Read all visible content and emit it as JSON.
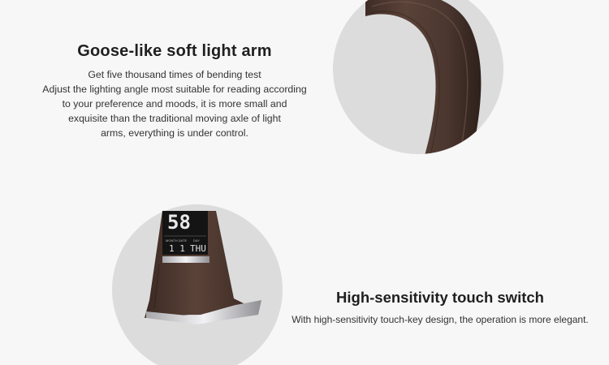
{
  "section_arm": {
    "title": "Goose-like soft light arm",
    "description_lines": [
      "Get five thousand times of bending test",
      "Adjust the lighting angle most suitable for reading according",
      "to your preference and moods, it is more small and",
      "exquisite than the traditional moving axle of light",
      "arms, everything is under control."
    ],
    "image_icon": "lamp-arm-photo"
  },
  "section_touch": {
    "title": "High-sensitivity touch switch",
    "description": "With high-sensitivity touch-key design, the operation is more elegant.",
    "image_icon": "lamp-base-photo",
    "display": {
      "big_digits": "58",
      "left_label": "MONTH DATE",
      "right_label": "DAY",
      "date_value": "1 1",
      "day_value": "THU"
    }
  },
  "colors": {
    "background": "#f7f7f7",
    "circle": "#dcdcdc",
    "leather": "#4e3a31",
    "leather_highlight": "#6b5247",
    "chrome": "#c9c9cc",
    "screen": "#141414"
  }
}
